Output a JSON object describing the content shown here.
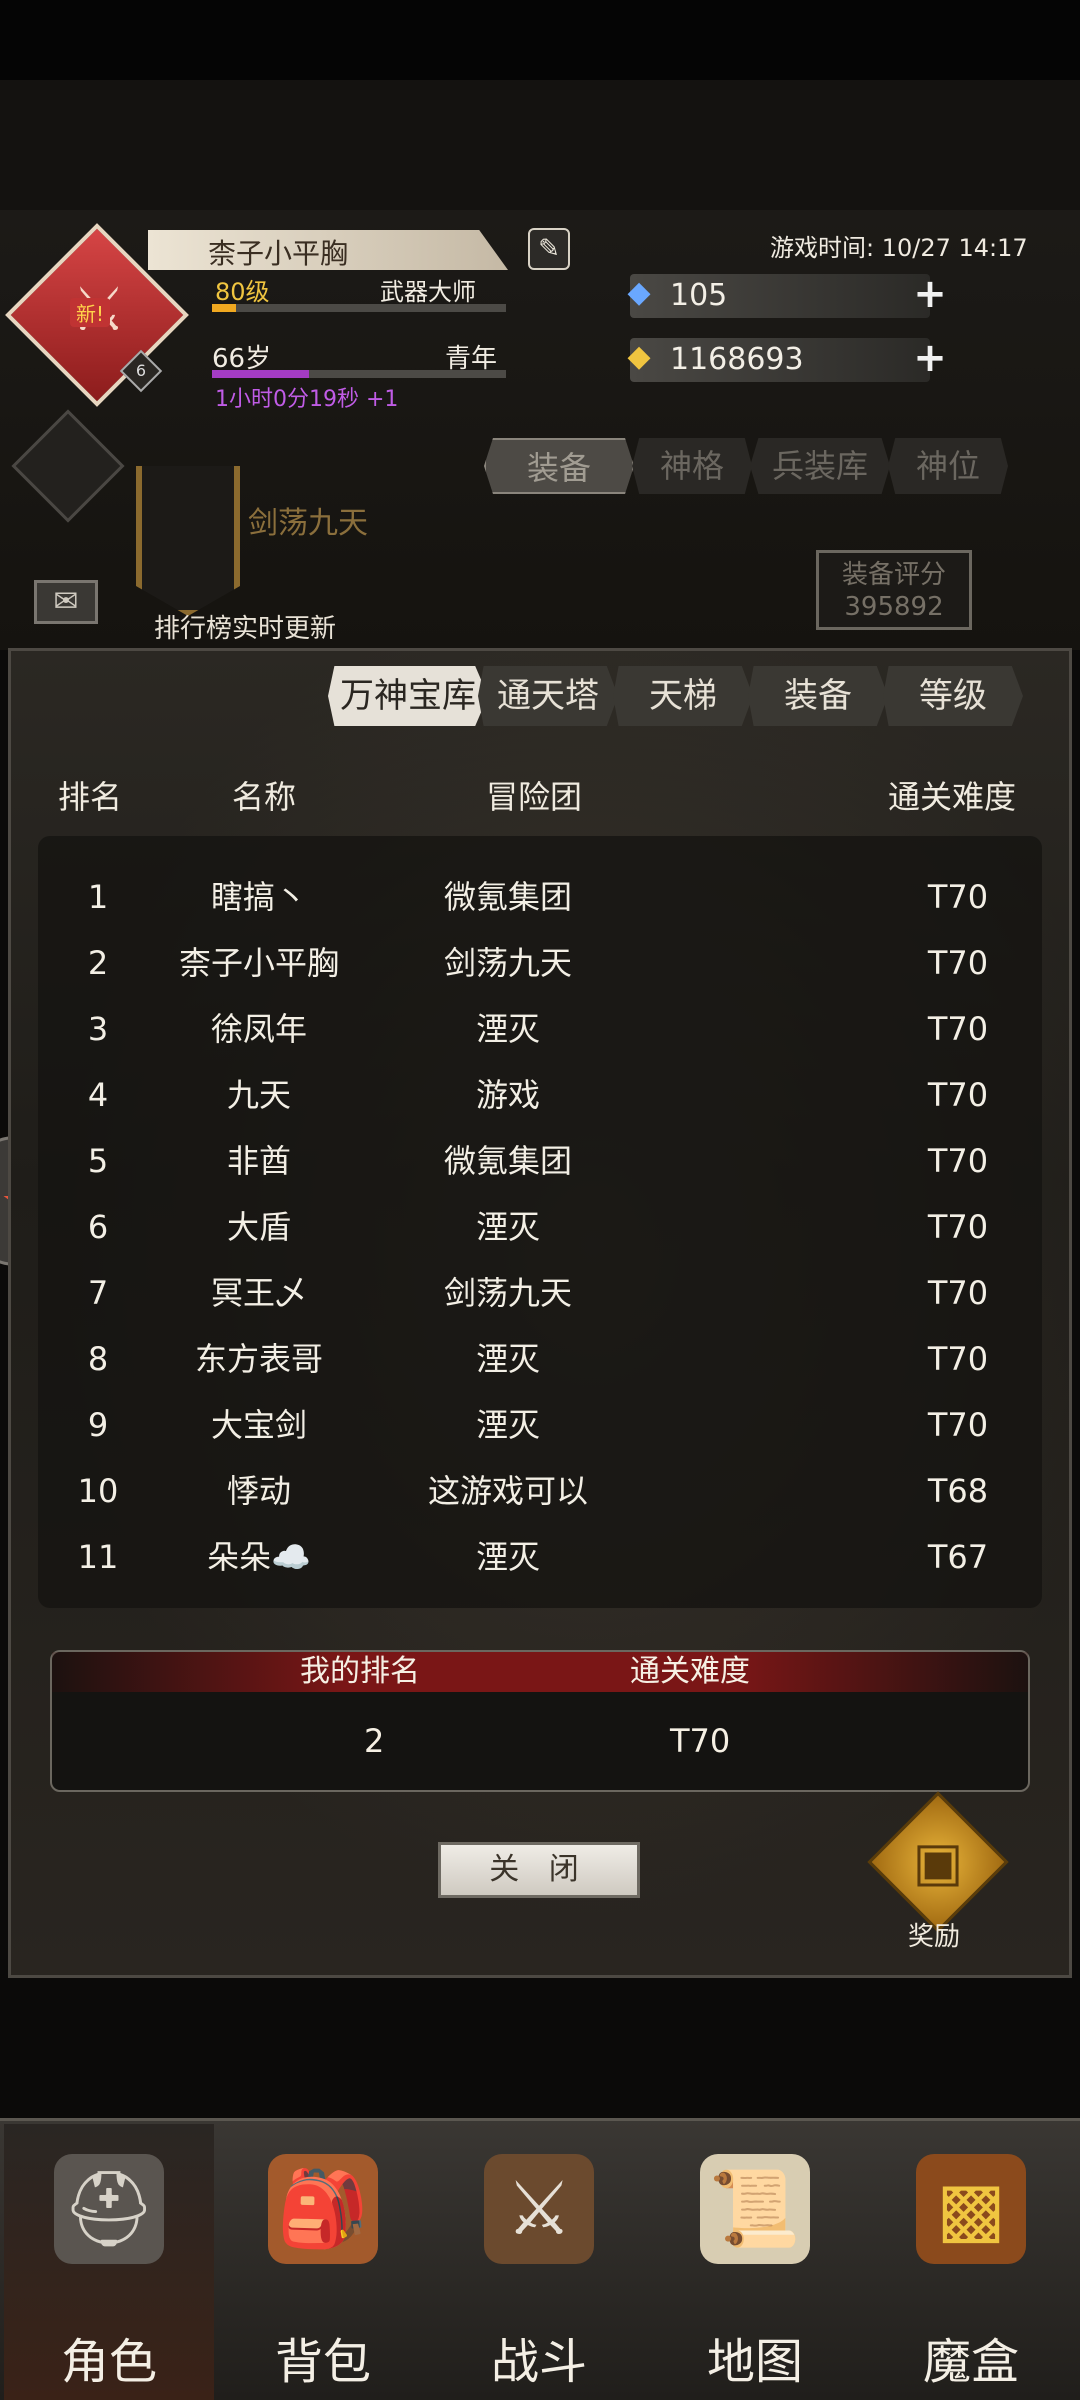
{
  "header": {
    "name": "柰子小平胸",
    "level": "80级",
    "class": "武器大师",
    "exp_progress": 0.08,
    "age": "66岁",
    "life_stage": "青年",
    "age_progress": 0.33,
    "timer": "1小时0分19秒 +1",
    "game_time": "游戏时间: 10/27 14:17",
    "gems": "105",
    "gold": "1168693",
    "avatar_badge": "新!",
    "avatar_level": "6",
    "guild": "剑荡九天",
    "rank_update": "排行榜实时更新",
    "tabs": [
      "装备",
      "神格",
      "兵装库",
      "神位"
    ],
    "score_label": "装备评分",
    "score_value": "395892"
  },
  "panel": {
    "tabs": [
      "万神宝库",
      "通天塔",
      "天梯",
      "装备",
      "等级"
    ],
    "columns": [
      "排名",
      "名称",
      "冒险团",
      "通关难度"
    ],
    "rows": [
      {
        "rank": "1",
        "name": "瞎搞丶",
        "guild": "微氪集团",
        "level": "T70"
      },
      {
        "rank": "2",
        "name": "柰子小平胸",
        "guild": "剑荡九天",
        "level": "T70"
      },
      {
        "rank": "3",
        "name": "徐凤年",
        "guild": "湮灭",
        "level": "T70"
      },
      {
        "rank": "4",
        "name": "九天",
        "guild": "游戏",
        "level": "T70"
      },
      {
        "rank": "5",
        "name": "非酋",
        "guild": "微氪集团",
        "level": "T70"
      },
      {
        "rank": "6",
        "name": "大盾",
        "guild": "湮灭",
        "level": "T70"
      },
      {
        "rank": "7",
        "name": "冥王乄",
        "guild": "剑荡九天",
        "level": "T70"
      },
      {
        "rank": "8",
        "name": "东方表哥",
        "guild": "湮灭",
        "level": "T70"
      },
      {
        "rank": "9",
        "name": "大宝剑",
        "guild": "湮灭",
        "level": "T70"
      },
      {
        "rank": "10",
        "name": "悸动",
        "guild": "这游戏可以",
        "level": "T68"
      },
      {
        "rank": "11",
        "name": "朵朵☁️",
        "guild": "湮灭",
        "level": "T67"
      }
    ],
    "my_rank_label": "我的排名",
    "my_level_label": "通关难度",
    "my_rank": "2",
    "my_level": "T70",
    "close_label": "关 闭",
    "reward_label": "奖励"
  },
  "nav": {
    "items": [
      {
        "label": "角色",
        "icon": "helmet-icon"
      },
      {
        "label": "背包",
        "icon": "backpack-icon"
      },
      {
        "label": "战斗",
        "icon": "sword-shield-icon"
      },
      {
        "label": "地图",
        "icon": "scroll-map-icon"
      },
      {
        "label": "魔盒",
        "icon": "magic-box-icon"
      }
    ]
  },
  "colors": {
    "gold_text": "#f0c540",
    "timer_purple": "#c05ce6",
    "accent_red": "#7a1616"
  }
}
